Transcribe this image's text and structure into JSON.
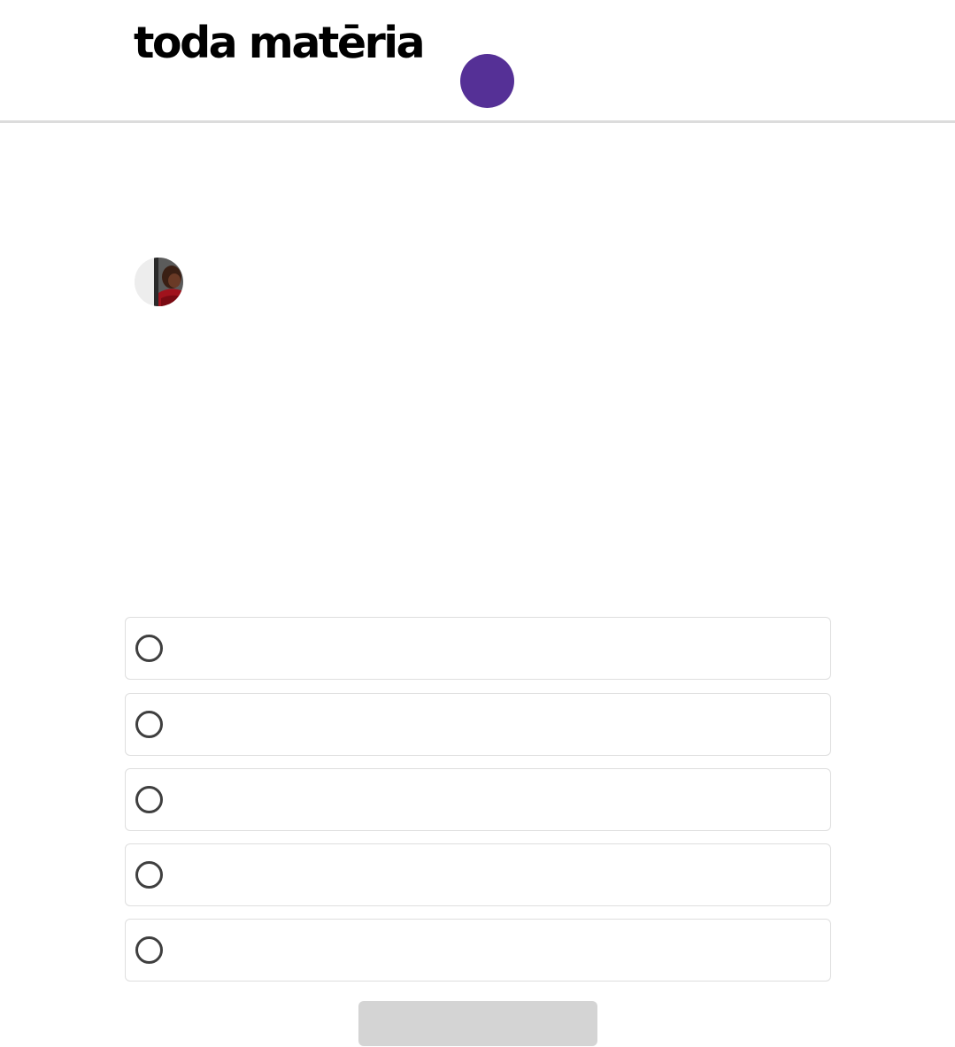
{
  "header": {
    "logo_text": "toda matēria",
    "menu_button_color": "#553096"
  },
  "author": {
    "avatar_icon": "author-avatar-photo"
  },
  "quiz": {
    "options": [
      {
        "label": "",
        "selected": false
      },
      {
        "label": "",
        "selected": false
      },
      {
        "label": "",
        "selected": false
      },
      {
        "label": "",
        "selected": false
      },
      {
        "label": "",
        "selected": false
      }
    ],
    "submit_label": "",
    "submit_color": "#d4d4d4"
  }
}
